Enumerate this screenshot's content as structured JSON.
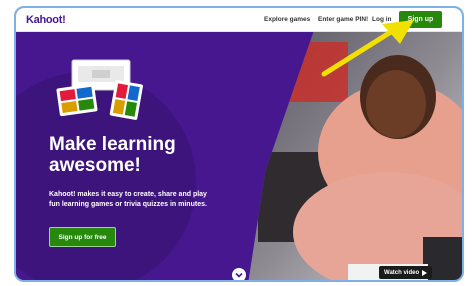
{
  "header": {
    "logo": "Kahoot!",
    "nav": {
      "explore": "Explore games",
      "pin": "Enter game PIN!",
      "login": "Log in",
      "signup": "Sign up"
    }
  },
  "hero": {
    "headline_line1": "Make learning",
    "headline_line2": "awesome!",
    "subtext": "Kahoot! makes it easy to create, share and play fun learning games or trivia quizzes in minutes.",
    "cta": "Sign up for free",
    "watch_video": "Watch video",
    "watch_video_icon": "play-triangle",
    "scroll_icon": "chevron-down"
  },
  "colors": {
    "brand_purple": "#46178f",
    "cta_green": "#26890c",
    "annotation_arrow": "#f2e100"
  }
}
